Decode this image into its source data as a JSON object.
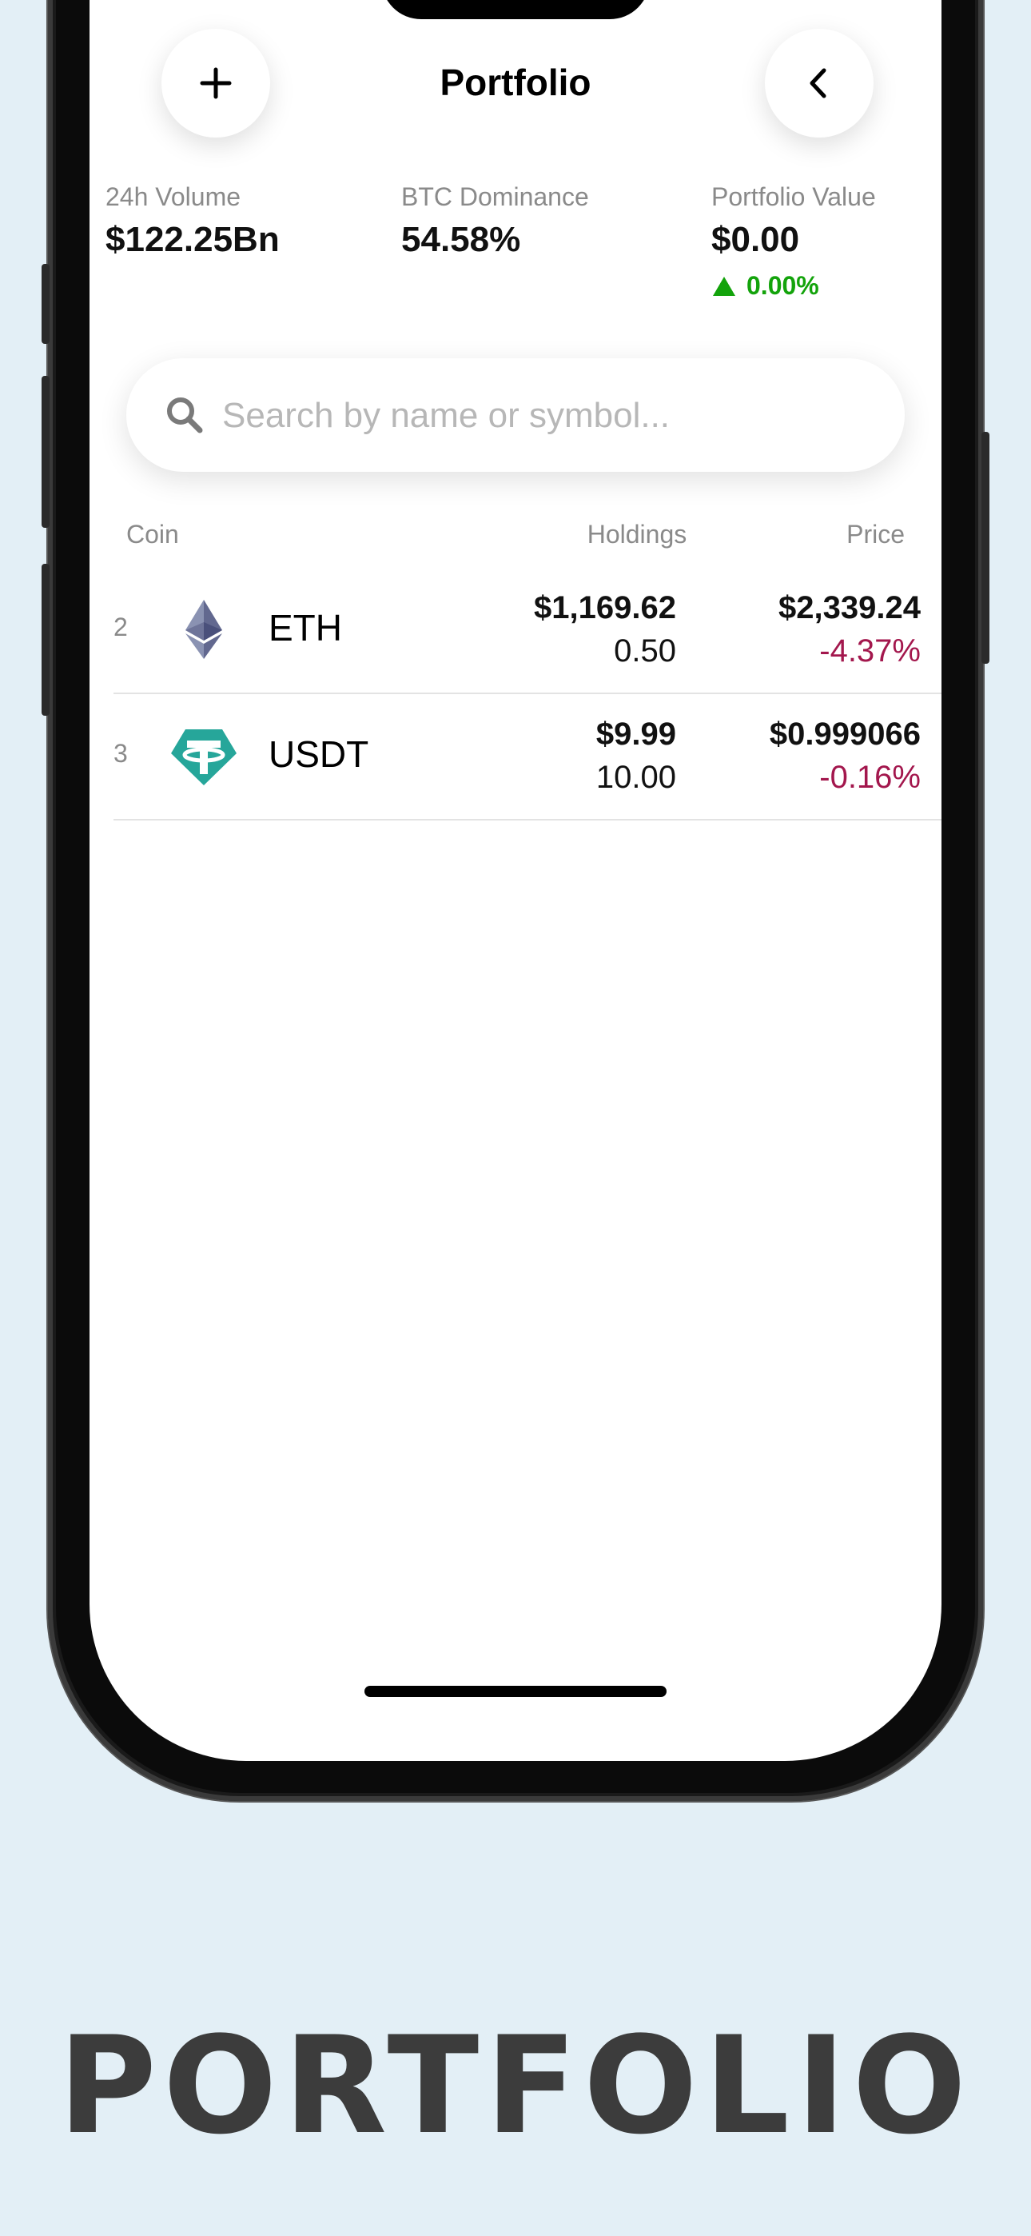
{
  "header": {
    "title": "Portfolio",
    "add_icon": "plus-icon",
    "back_icon": "chevron-left-icon"
  },
  "stats": {
    "volume": {
      "label": "24h Volume",
      "value": "$122.25Bn"
    },
    "dominance": {
      "label": "BTC Dominance",
      "value": "54.58%"
    },
    "portfolio": {
      "label": "Portfolio Value",
      "value": "$0.00",
      "change": "0.00%",
      "change_icon": "triangle-up-icon",
      "change_color": "#13a30b"
    }
  },
  "search": {
    "placeholder": "Search by name or symbol...",
    "value": ""
  },
  "table": {
    "columns": {
      "coin": "Coin",
      "holdings": "Holdings",
      "price": "Price"
    },
    "rows": [
      {
        "rank": "2",
        "symbol": "ETH",
        "icon": "ethereum-icon",
        "holdings_value": "$1,169.62",
        "holdings_qty": "0.50",
        "price": "$2,339.24",
        "change": "-4.37%"
      },
      {
        "rank": "3",
        "symbol": "USDT",
        "icon": "tether-icon",
        "holdings_value": "$9.99",
        "holdings_qty": "10.00",
        "price": "$0.999066",
        "change": "-0.16%"
      }
    ]
  },
  "colors": {
    "negative": "#a3174d",
    "positive": "#13a30b",
    "background": "#e3eff6"
  },
  "caption": "PORTFOLIO"
}
